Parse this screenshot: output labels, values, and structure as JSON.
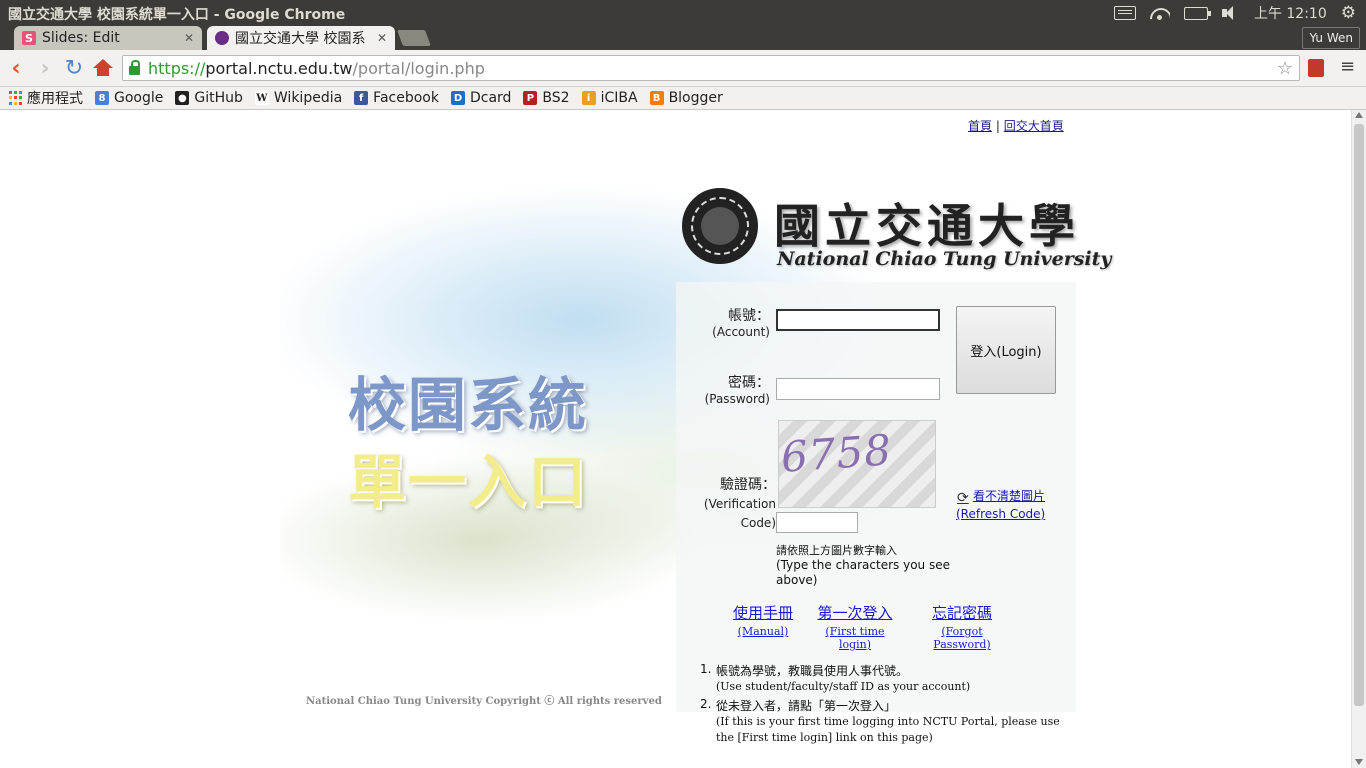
{
  "window": {
    "title": "國立交通大學 校園系統單一入口 - Google Chrome"
  },
  "system_tray": {
    "clock": "上午 12:10"
  },
  "tabs": [
    {
      "label": "Slides: Edit",
      "favicon": "S",
      "active": false
    },
    {
      "label": "國立交通大學 校園系",
      "active": true
    }
  ],
  "profile": {
    "name": "Yu Wen"
  },
  "omnibox": {
    "scheme": "https://",
    "host": "portal.nctu.edu.tw",
    "path": "/portal/login.php"
  },
  "bookmarks": [
    {
      "label": "應用程式",
      "icon": "apps-grid-icon"
    },
    {
      "label": "Google",
      "icon": "google-icon",
      "glyph": "8",
      "color": "#4a7fd6"
    },
    {
      "label": "GitHub",
      "icon": "github-icon",
      "glyph": "●",
      "color": "#222222"
    },
    {
      "label": "Wikipedia",
      "icon": "wikipedia-icon",
      "glyph": "W",
      "color": "#ffffff"
    },
    {
      "label": "Facebook",
      "icon": "facebook-icon",
      "glyph": "f",
      "color": "#3b5998"
    },
    {
      "label": "Dcard",
      "icon": "dcard-icon",
      "glyph": "D",
      "color": "#1e6ec8"
    },
    {
      "label": "BS2",
      "icon": "bs2-icon",
      "glyph": "P",
      "color": "#b22222"
    },
    {
      "label": "iCIBA",
      "icon": "iciba-icon",
      "glyph": "i",
      "color": "#e8a020"
    },
    {
      "label": "Blogger",
      "icon": "blogger-icon",
      "glyph": "B",
      "color": "#f57d00"
    }
  ],
  "page": {
    "top_links": {
      "home": "首頁",
      "separator": "|",
      "university_home": "回交大首頁"
    },
    "hero": {
      "title_line1": "校園系統",
      "title_line2": "單一入口",
      "copyright": "National Chiao Tung University Copyright ⓒ All rights reserved"
    },
    "logo": {
      "name_zh": "國立交通大學",
      "name_en": "National Chiao Tung University"
    },
    "form": {
      "account_label_zh": "帳號：",
      "account_label_en": "(Account)",
      "account_value": "",
      "password_label_zh": "密碼：",
      "password_label_en": "(Password)",
      "password_value": "",
      "captcha_label_zh": "驗證碼：",
      "captcha_label_en": "(Verification Code)",
      "captcha_image_text": "6758",
      "captcha_value": "",
      "login_button": "登入(Login)",
      "refresh_zh": "看不清楚圖片",
      "refresh_en": "(Refresh Code)",
      "captcha_hint_zh": "請依照上方圖片數字輸入",
      "captcha_hint_en": "(Type the characters you see above)"
    },
    "links": [
      {
        "zh": "使用手冊",
        "en": "(Manual)"
      },
      {
        "zh": "第一次登入",
        "en": "(First time login)"
      },
      {
        "zh": "忘記密碼",
        "en": "(Forgot Password)"
      }
    ],
    "notes": [
      {
        "num": "1.",
        "zh": "帳號為學號，教職員使用人事代號。",
        "en": "(Use student/faculty/staff ID as your account)"
      },
      {
        "num": "2.",
        "zh": "從未登入者，請點「第一次登入」",
        "en": "(If this is your first time logging into NCTU Portal, please use the [First time login] link on this page)"
      }
    ]
  }
}
